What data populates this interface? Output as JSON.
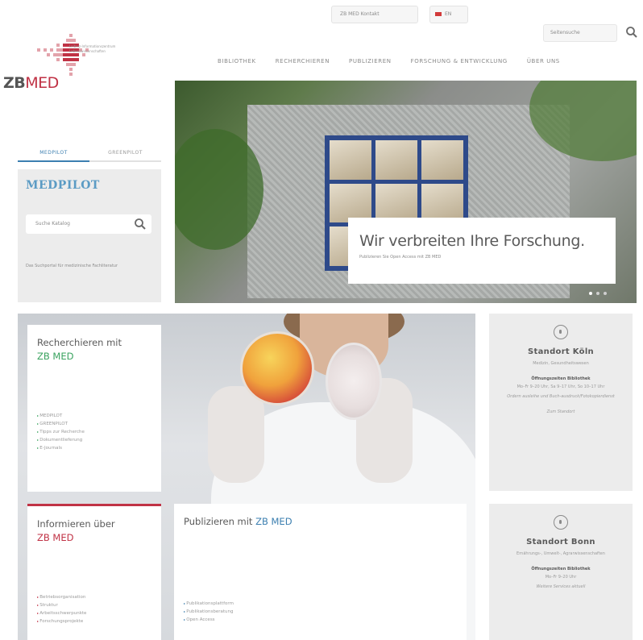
{
  "topbar": {
    "contact_label": "ZB MED Kontakt",
    "language_label": "EN",
    "search_placeholder": "Seitensuche"
  },
  "logo": {
    "zb": "ZB",
    "med": "MED",
    "tagline_1": "Leibniz-Informationszentrum",
    "tagline_2": "Lebenswissenschaften"
  },
  "nav": [
    "BIBLIOTHEK",
    "RECHERCHIEREN",
    "PUBLIZIEREN",
    "FORSCHUNG & ENTWICKLUNG",
    "ÜBER UNS"
  ],
  "hero": {
    "headline": "Wir verbreiten Ihre Forschung.",
    "subline": "Publizieren Sie Open Access mit ZB MED",
    "slide_count": 3,
    "active_slide": 1
  },
  "pilot": {
    "tabs": [
      "MEDPILOT",
      "GREENPILOT"
    ],
    "active_tab": 0,
    "title": "MEDPILOT",
    "search_placeholder": "Suche Katalog",
    "description": "Das Suchportal für medizinische Fachliteratur"
  },
  "cards": {
    "research": {
      "title_prefix": "Recherchieren mit",
      "title_highlight": "ZB MED",
      "items": [
        "MEDPILOT",
        "GREENPILOT",
        "Tipps zur Recherche",
        "Dokumentlieferung",
        "E-Journals"
      ]
    },
    "info": {
      "title_prefix": "Informieren über",
      "title_highlight": "ZB MED",
      "items": [
        "Betriebsorganisation",
        "Struktur",
        "Arbeitsschwerpunkte",
        "Forschungsprojekte"
      ]
    },
    "publish": {
      "title_prefix": "Publizieren mit",
      "title_highlight": "ZB MED",
      "items": [
        "Publikationsplattform",
        "Publikationsberatung",
        "Open Access"
      ]
    }
  },
  "locations": {
    "koeln": {
      "name": "Standort Köln",
      "subtitle": "Medizin, Gesundheitswesen",
      "hours_label": "Öffnungszeiten Bibliothek",
      "hours": "Mo–Fr 9–20 Uhr, Sa 9–17 Uhr, So 10–17 Uhr",
      "note": "Ordern ausleihe und Buch-ausdruck/Fotokopierdienst",
      "link": "Zum Standort"
    },
    "bonn": {
      "name": "Standort Bonn",
      "subtitle": "Ernährungs-, Umwelt-, Agrarwissenschaften",
      "hours_label": "Öffnungszeiten Bibliothek",
      "hours": "Mo–Fr 9–20 Uhr",
      "note": "Weitere Services aktuell",
      "link": "Zum Standort"
    }
  },
  "colors": {
    "brand_red": "#c03245",
    "accent_blue": "#3c7fb0",
    "accent_green": "#3aa35f",
    "panel_gray": "#ececec"
  }
}
